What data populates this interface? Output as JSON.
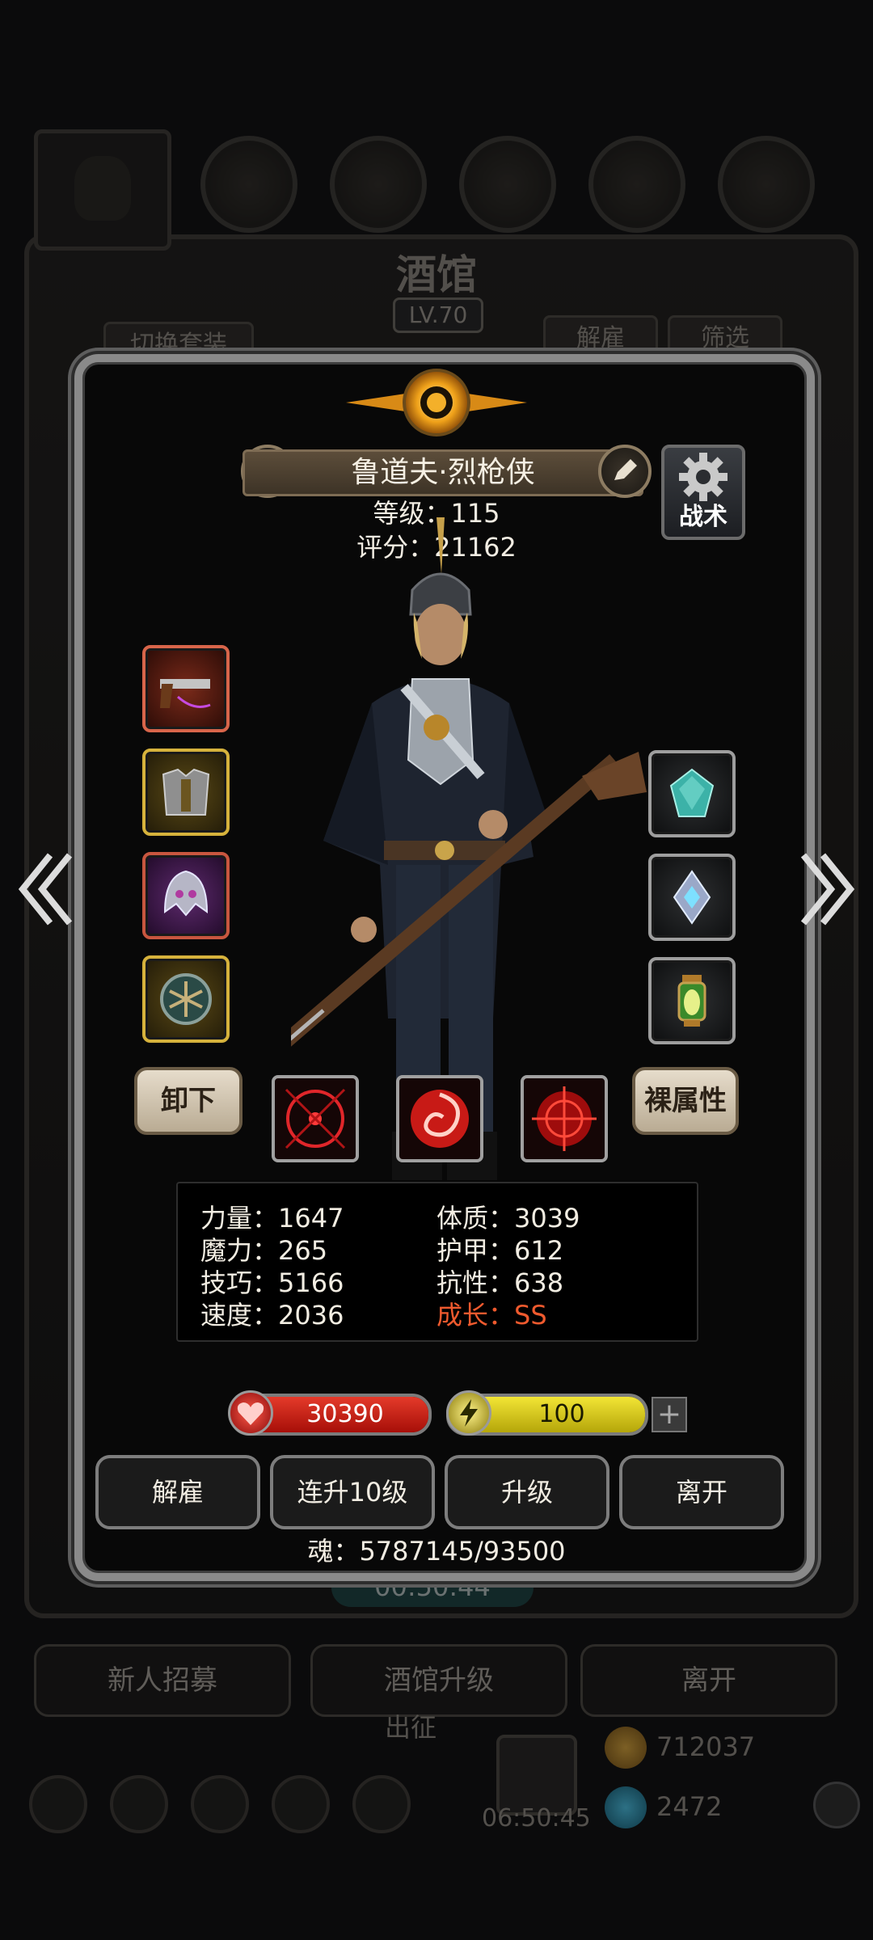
{
  "background": {
    "title": "酒馆",
    "level": "LV.70",
    "switch_outfit": "切换套装",
    "dismiss": "解雇",
    "filter": "筛选",
    "timer": "00:50:44",
    "recruit": "新人招募",
    "tavern_upgrade": "酒馆升级",
    "leave": "离开",
    "expedition": "出征",
    "gift_timer": "06:50:45",
    "gold": "712037",
    "gems": "2472"
  },
  "hero": {
    "name": "鲁道夫·烈枪侠",
    "level_line": "等级：115",
    "score_line": "评分：21162",
    "tactics_label": "战术"
  },
  "equipment": {
    "left": [
      {
        "icon": "pistol-icon",
        "rarity": "red"
      },
      {
        "icon": "armor-icon",
        "rarity": "gold"
      },
      {
        "icon": "helmet-icon",
        "rarity": "purple"
      },
      {
        "icon": "shield-icon",
        "rarity": "gold"
      }
    ],
    "right": [
      {
        "icon": "gem-icon",
        "rarity": "grey"
      },
      {
        "icon": "amulet-icon",
        "rarity": "grey"
      },
      {
        "icon": "lantern-icon",
        "rarity": "grey"
      }
    ],
    "unequip": "卸下",
    "base_attributes": "裸属性"
  },
  "skills": [
    "crosshair-skill-icon",
    "vortex-skill-icon",
    "target-skill-icon"
  ],
  "stats": {
    "strength": "力量：1647",
    "magic": "魔力：265",
    "skill": "技巧：5166",
    "speed": "速度：2036",
    "constitution": "体质：3039",
    "armor": "护甲：612",
    "resistance": "抗性：638",
    "growth": "成长：SS"
  },
  "bars": {
    "hp": "30390",
    "energy": "100",
    "hp_color": "#d21e14",
    "energy_color": "#e2d21e",
    "plus": "+"
  },
  "actions": {
    "dismiss": "解雇",
    "level10": "连升10级",
    "upgrade": "升级",
    "leave": "离开"
  },
  "soul_line": "魂：5787145/93500",
  "colors": {
    "growth": "#ef5a2e",
    "frame": "#8a8a8a"
  }
}
